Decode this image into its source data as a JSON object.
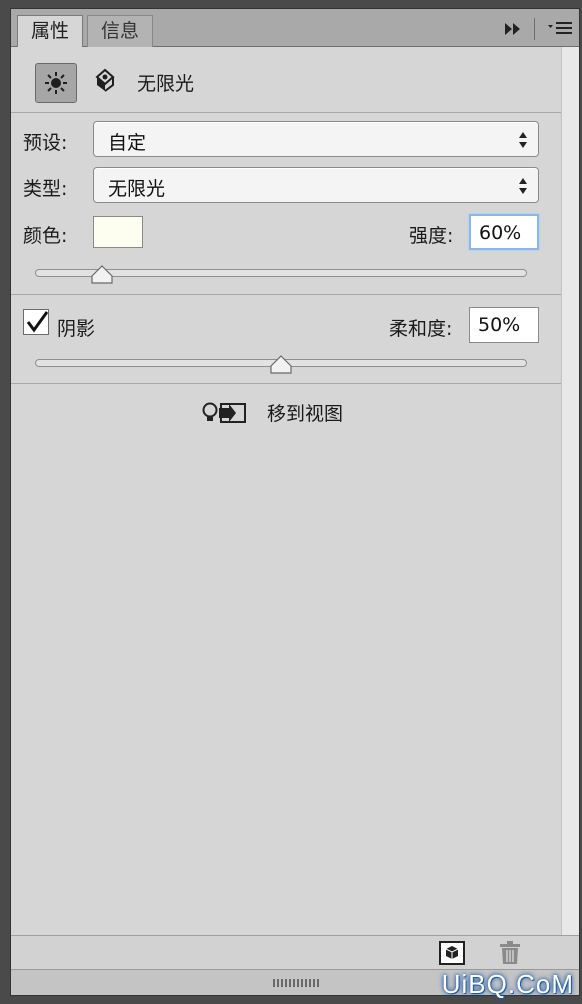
{
  "tabs": [
    {
      "label": "属性",
      "active": true
    },
    {
      "label": "信息",
      "active": false
    }
  ],
  "tabbar_icons": [
    "collapse-icon",
    "panel-menu-icon"
  ],
  "header": {
    "light_name": "无限光",
    "icons": [
      "infinite-light-icon",
      "light-3d-icon"
    ]
  },
  "preset": {
    "label": "预设:",
    "value": "自定"
  },
  "type": {
    "label": "类型:",
    "value": "无限光"
  },
  "color": {
    "label": "颜色:",
    "swatch": "#fefef0"
  },
  "intensity": {
    "label": "强度:",
    "value": "60%",
    "level": 0.6
  },
  "shadow": {
    "label": "阴影",
    "checked": true
  },
  "softness": {
    "label": "柔和度:",
    "value": "50%",
    "level": 0.5
  },
  "move_to_view": {
    "label": "移到视图"
  },
  "footer_icons": [
    "new-3d-layer-icon",
    "trash-icon"
  ],
  "watermark": "UiBQ.CoM"
}
